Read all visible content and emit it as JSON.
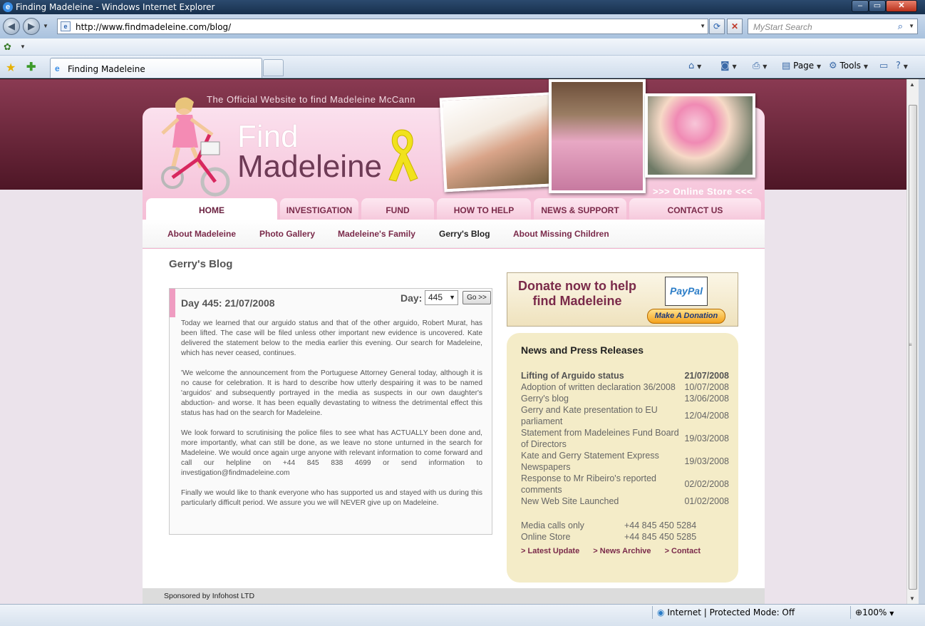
{
  "window": {
    "title": "Finding Madeleine - Windows Internet Explorer",
    "min_icon": "minimize-icon",
    "max_icon": "maximize-icon",
    "close_glyph": "✕"
  },
  "browser": {
    "url": "http://www.findmadeleine.com/blog/",
    "search_placeholder": "MyStart Search",
    "tab_title": "Finding Madeleine",
    "commands": {
      "page": "Page",
      "tools": "Tools"
    },
    "status": {
      "zone": "Internet | Protected Mode: Off",
      "zoom": "100%"
    }
  },
  "site": {
    "tagline": "The Official Website to find Madeleine McCann",
    "logo_line1": "Find",
    "logo_line2": "Madeleine",
    "online_store": ">>> Online Store <<<",
    "main_nav": [
      "HOME",
      "INVESTIGATION",
      "FUND",
      "HOW TO HELP",
      "NEWS & SUPPORT",
      "CONTACT US"
    ],
    "sub_nav": [
      "About Madeleine",
      "Photo Gallery",
      "Madeleine's Family",
      "Gerry's Blog",
      "About Missing Children"
    ],
    "page_title": "Gerry's Blog",
    "blog": {
      "heading": "Day 445: 21/07/2008",
      "day_label": "Day:",
      "day_value": "445",
      "go_label": "Go >>",
      "paragraphs": [
        "Today we learned that our arguido status and that of the other arguido, Robert Murat, has been lifted. The case will be filed unless other important new evidence is uncovered. Kate delivered the statement below to the media earlier this evening. Our search for Madeleine, which has never ceased, continues.",
        "'We welcome the announcement from the Portuguese Attorney General today, although it is no cause for celebration. It is hard to describe how utterly despairing it was to be named 'arguidos' and subsequently portrayed in the media as suspects in our own daughter's abduction- and worse. It has been equally devastating to witness the detrimental effect this status has had on the search for Madeleine.",
        "We look forward to scrutinising the police files to see what has ACTUALLY been done and, more importantly, what can still be done, as we leave no stone unturned in the search for Madeleine. We would once again urge anyone with relevant information to come forward and call our helpline on +44 845 838 4699 or send information to investigation@findmadeleine.com",
        "Finally we would like to thank everyone who has supported us and stayed with us during this particularly difficult period. We assure you we will NEVER give up on Madeleine."
      ]
    },
    "donate": {
      "text": "Donate now to help find Madeleine",
      "paypal_a": "Pay",
      "paypal_b": "Pal",
      "button": "Make A Donation"
    },
    "news": {
      "title": "News and Press Releases",
      "items": [
        {
          "title": "Lifting of Arguido status",
          "date": "21/07/2008"
        },
        {
          "title": "Adoption of written declaration 36/2008",
          "date": "10/07/2008"
        },
        {
          "title": "Gerry's blog",
          "date": "13/06/2008"
        },
        {
          "title": "Gerry and Kate presentation to EU parliament",
          "date": "12/04/2008"
        },
        {
          "title": "Statement from Madeleines Fund Board of Directors",
          "date": "19/03/2008"
        },
        {
          "title": "Kate and Gerry Statement Express Newspapers",
          "date": "19/03/2008"
        },
        {
          "title": "Response to Mr Ribeiro's reported comments",
          "date": "02/02/2008"
        },
        {
          "title": "New Web Site Launched",
          "date": "01/02/2008"
        }
      ],
      "contacts": [
        {
          "label": "Media calls only",
          "value": "+44 845 450 5284"
        },
        {
          "label": "Online Store",
          "value": "+44 845 450 5285"
        }
      ],
      "links": [
        "> Latest Update",
        "> News Archive",
        "> Contact"
      ]
    },
    "sponsor": "Sponsored by Infohost LTD"
  },
  "colors": {
    "brand_plum": "#7a2a4a",
    "band": "#6a2338",
    "pink": "#f3b4cf",
    "news_bg": "#f4ecc8"
  }
}
